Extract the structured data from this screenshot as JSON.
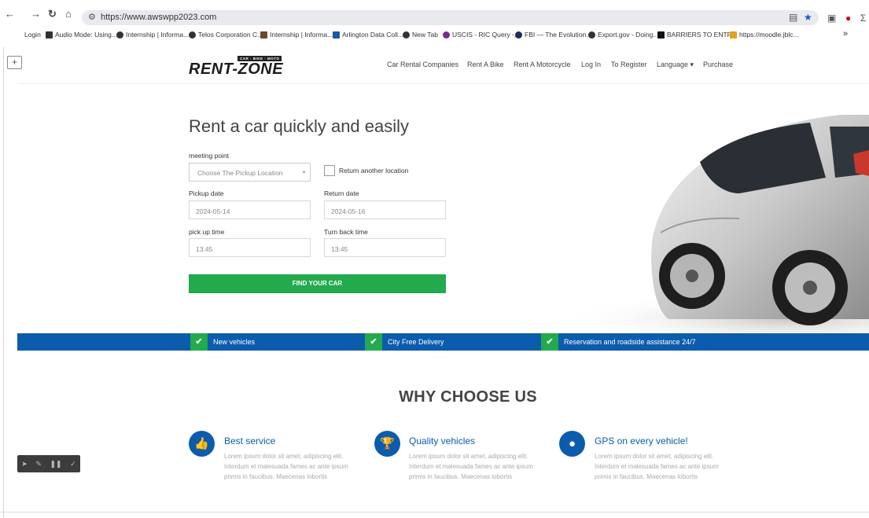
{
  "browser": {
    "url": "https://www.awswpp2023.com",
    "bookmarks": [
      "Login",
      "Audio Mode: Using...",
      "Internship | Informa...",
      "Telos Corporation C...",
      "Internship | Informa...",
      "Arlington Data Coll...",
      "New Tab",
      "USCIS - RIC Query -...",
      "FBI — The Evolution...",
      "Export.gov - Doing...",
      "BARRIERS TO ENTR...",
      "https://moodle.jblc..."
    ],
    "more_bookmarks": "»"
  },
  "site": {
    "logo_text": "RENT-ZONE",
    "logo_tag": "CAR · BIKE · MOTO",
    "nav": [
      "Car Rental Companies",
      "Rent A Bike",
      "Rent A Motorcycle",
      "Log In",
      "To Register",
      "Language ▾",
      "Purchase"
    ]
  },
  "hero": {
    "title": "Rent a car quickly and easily",
    "meeting_point_label": "meeting point",
    "meeting_point_value": "Choose The Pickup Location",
    "return_another_label": "Return another location",
    "pickup_date_label": "Pickup date",
    "pickup_date_value": "2024-05-14",
    "return_date_label": "Return date",
    "return_date_value": "2024-05-16",
    "pickup_time_label": "pick up time",
    "pickup_time_value": "13:45",
    "turnback_time_label": "Turn back time",
    "turnback_time_value": "13:45",
    "find_button": "FIND YOUR CAR"
  },
  "features": [
    "New vehicles",
    "City Free Delivery",
    "Reservation and roadside assistance 24/7"
  ],
  "why": {
    "title": "WHY CHOOSE US",
    "items": [
      {
        "title": "Best service",
        "icon": "thumbs-up-icon",
        "text": "Lorem ipsum dolor sit amet, adipiscing elit. Interdum et malesuada fames ac ante ipsum primis in faucibus. Maecenas lobortis"
      },
      {
        "title": "Quality vehicles",
        "icon": "trophy-icon",
        "text": "Lorem ipsum dolor sit amet, adipiscing elit. Interdum et malesuada fames ac ante ipsum primis in faucibus. Maecenas lobortis"
      },
      {
        "title": "GPS on every vehicle!",
        "icon": "map-pin-icon",
        "text": "Lorem ipsum dolor sit amet, adipiscing elit. Interdum et malesuada fames ac ante ipsum primis in faucibus. Maecenas lobortis"
      }
    ]
  },
  "colors": {
    "brand_blue": "#0b5cad",
    "accent_green": "#22aa4c"
  }
}
